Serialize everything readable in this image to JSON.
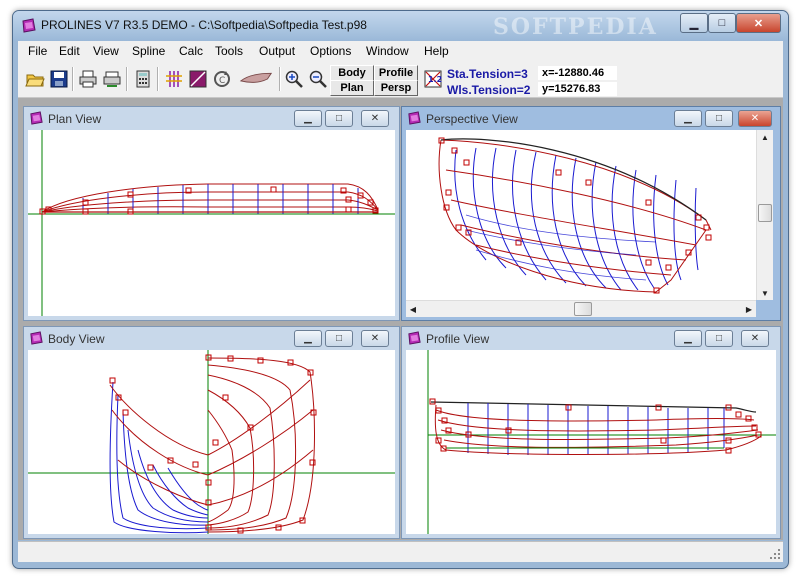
{
  "window": {
    "title": "PROLINES V7 R3.5 DEMO - C:\\Softpedia\\Softpedia Test.p98",
    "watermark": "SOFTPEDIA",
    "controls": {
      "minimize": "▁",
      "maximize": "□",
      "close": "✕"
    }
  },
  "menu": [
    "File",
    "Edit",
    "View",
    "Spline",
    "Calc",
    "Tools",
    "Output",
    "Options",
    "Window",
    "Help"
  ],
  "toolbar": {
    "view_buttons": {
      "body": "Body",
      "profile": "Profile",
      "plan": "Plan",
      "persp": "Persp"
    },
    "sta_tension": "Sta.Tension=3",
    "wls_tension": "Wls.Tension=2",
    "x_coord": "x=-12880.46",
    "y_coord": "y=15276.83"
  },
  "views": {
    "plan": {
      "title": "Plan View"
    },
    "perspective": {
      "title": "Perspective View"
    },
    "body": {
      "title": "Body View"
    },
    "profile": {
      "title": "Profile View"
    }
  },
  "colors": {
    "station_lines": "#1a1ad0",
    "waterlines": "#b01010",
    "axis": "#008000",
    "control_points": "#c00000",
    "active_title": "#9fbde0",
    "inactive_title": "#c8d8ea"
  }
}
